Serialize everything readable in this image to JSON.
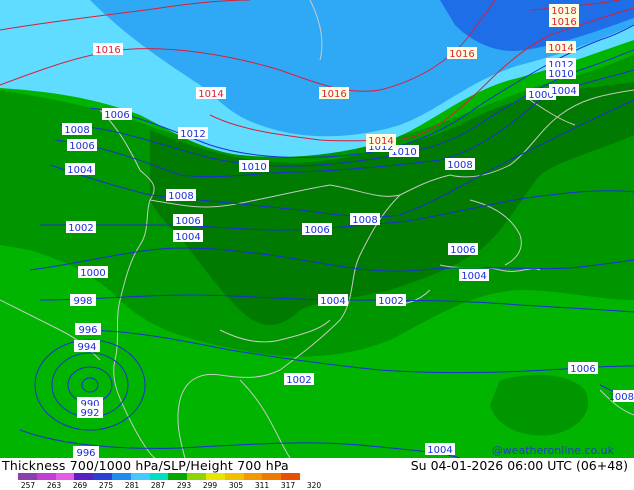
{
  "footer": {
    "title": "Thickness 700/1000 hPa/SLP/Height 700 hPa",
    "valid_time": "Su 04-01-2026 06:00 UTC (06+48)",
    "credit": "@weatheronline.co.uk"
  },
  "colorbar": {
    "ticks": [
      "257",
      "263",
      "269",
      "275",
      "281",
      "287",
      "293",
      "299",
      "305",
      "311",
      "317",
      "320"
    ],
    "colors": [
      "#8c3fa8",
      "#c23fd6",
      "#e35be6",
      "#5a1fc0",
      "#2a3fd6",
      "#1f8cf0",
      "#46c8ff",
      "#00e0c0",
      "#00a800",
      "#8fd400",
      "#e6e600",
      "#f0c000",
      "#f09a00",
      "#f07a00",
      "#e85000"
    ]
  },
  "map": {
    "colors": {
      "bright_green": "#00b400",
      "mid_green": "#009600",
      "dark_green": "#007a00",
      "cyan": "#5fdcff",
      "light_blue": "#2fa8f5",
      "blue": "#1e6ee8",
      "isobar": "#1a2fd6",
      "height_contour": "#d8203a",
      "coastline": "#c8c8c8"
    },
    "isobar_labels": [
      "1016",
      "1014",
      "1012",
      "1010",
      "1008",
      "1006",
      "1004",
      "1002",
      "1000",
      "998",
      "996",
      "994",
      "992",
      "990",
      "1016",
      "1014",
      "1014",
      "1012",
      "1012",
      "1010",
      "1010",
      "1008",
      "1008",
      "1006",
      "1006",
      "1006",
      "1004",
      "1004",
      "1004",
      "1004",
      "1008",
      "1006",
      "1006",
      "1004",
      "1002",
      "1004",
      "1002",
      "1006",
      "1000",
      "1004",
      "1006",
      "1004"
    ],
    "height_labels": [
      "1016",
      "1014",
      "1016",
      "1016",
      "1014",
      "1012",
      "1018",
      "1016",
      "1014"
    ]
  }
}
